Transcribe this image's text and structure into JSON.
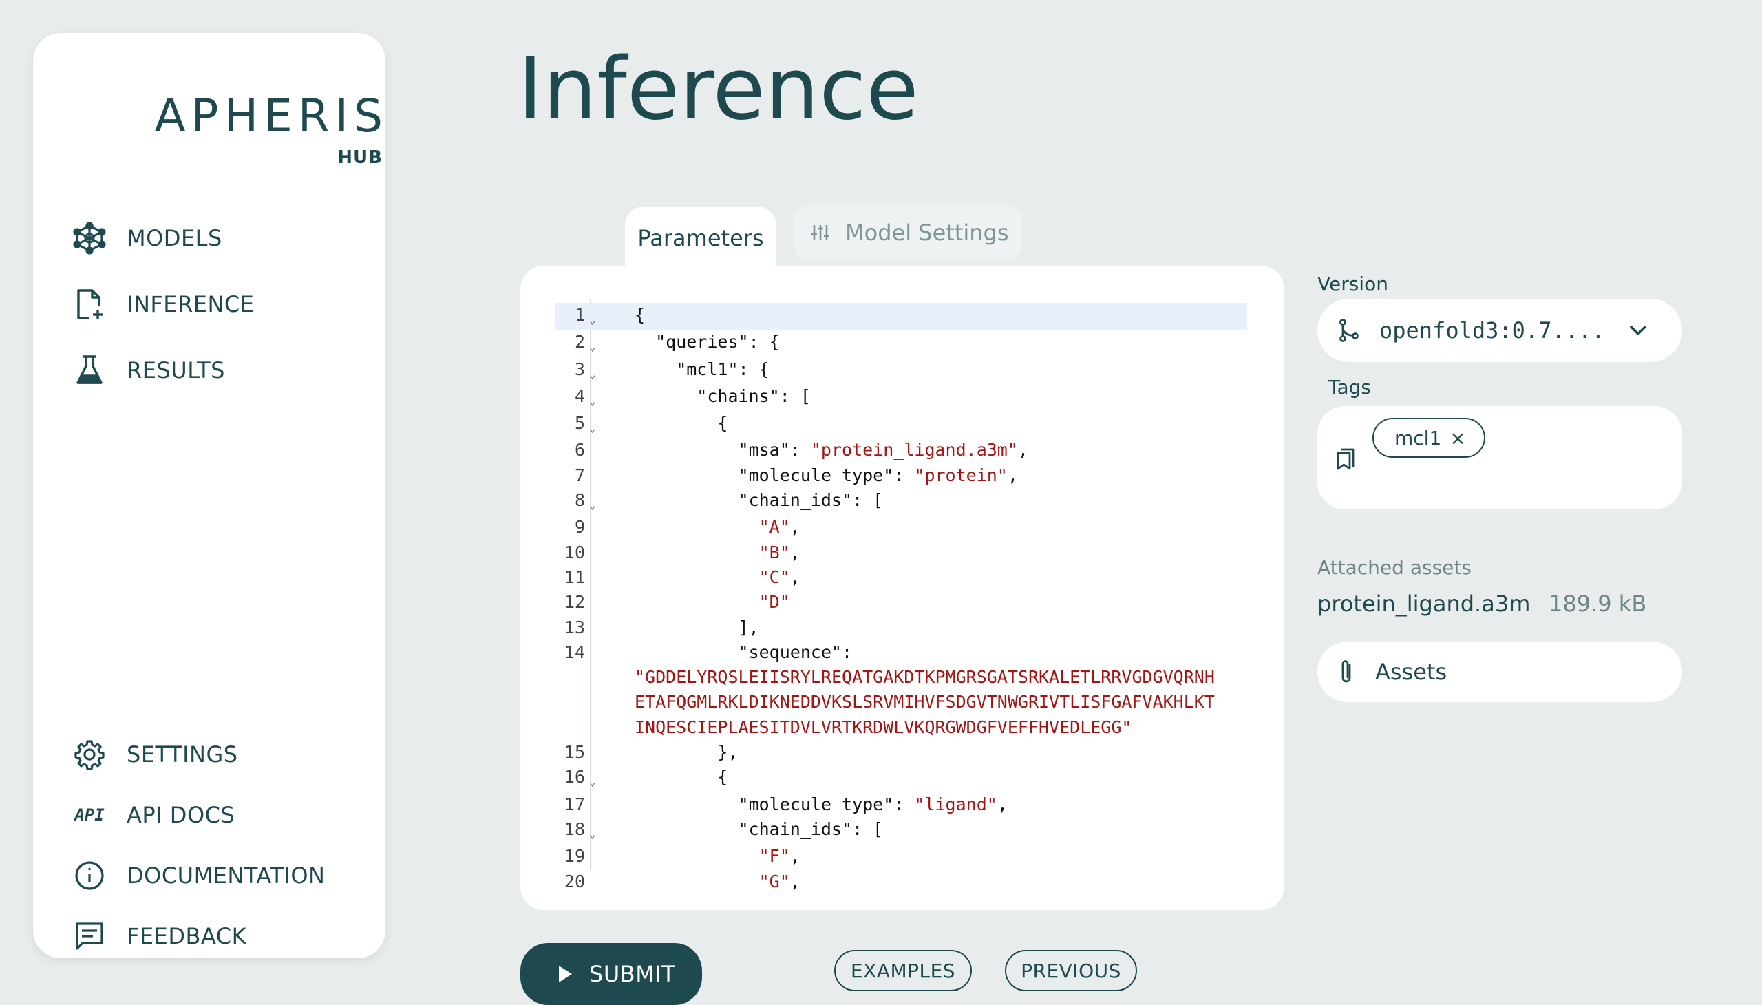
{
  "brand": {
    "name": "APHERIS",
    "sub": "HUB"
  },
  "nav": {
    "models": "MODELS",
    "inference": "INFERENCE",
    "results": "RESULTS",
    "settings": "SETTINGS",
    "api_docs": "API DOCS",
    "api_glyph": "API",
    "documentation": "DOCUMENTATION",
    "feedback": "FEEDBACK"
  },
  "page": {
    "title": "Inference"
  },
  "tabs": {
    "parameters": "Parameters",
    "model_settings": "Model Settings"
  },
  "editor": {
    "active_line": 1,
    "lines": [
      {
        "num": "1",
        "fold": true,
        "text": "{"
      },
      {
        "num": "2",
        "fold": true,
        "text": "  \"queries\": {"
      },
      {
        "num": "3",
        "fold": true,
        "text": "    \"mcl1\": {"
      },
      {
        "num": "4",
        "fold": true,
        "text": "      \"chains\": ["
      },
      {
        "num": "5",
        "fold": true,
        "text": "        {"
      },
      {
        "num": "6",
        "fold": false,
        "text": "          \"msa\": ",
        "str": "\"protein_ligand.a3m\"",
        "tail": ","
      },
      {
        "num": "7",
        "fold": false,
        "text": "          \"molecule_type\": ",
        "str": "\"protein\"",
        "tail": ","
      },
      {
        "num": "8",
        "fold": true,
        "text": "          \"chain_ids\": ["
      },
      {
        "num": "9",
        "fold": false,
        "text": "            ",
        "str": "\"A\"",
        "tail": ","
      },
      {
        "num": "10",
        "fold": false,
        "text": "            ",
        "str": "\"B\"",
        "tail": ","
      },
      {
        "num": "11",
        "fold": false,
        "text": "            ",
        "str": "\"C\"",
        "tail": ","
      },
      {
        "num": "12",
        "fold": false,
        "text": "            ",
        "str": "\"D\"",
        "tail": ""
      },
      {
        "num": "13",
        "fold": false,
        "text": "          ],"
      },
      {
        "num": "14",
        "fold": false,
        "text": "          \"sequence\":"
      },
      {
        "num": "",
        "wrap": true,
        "str": "\"GDDELYRQSLEIISRYLREQATGAKDTKPMGRSGATSRKALETLRRVGDGVQRNH"
      },
      {
        "num": "",
        "wrap": true,
        "str": "ETAFQGMLRKLDIKNEDDVKSLSRVMIHVFSDGVTNWGRIVTLISFGAFVAKHLKT"
      },
      {
        "num": "",
        "wrap": true,
        "str": "INQESCIEPLAESITDVLVRTKRDWLVKQRGWDGFVEFFHVEDLEGG\""
      },
      {
        "num": "15",
        "fold": false,
        "text": "        },"
      },
      {
        "num": "16",
        "fold": true,
        "text": "        {"
      },
      {
        "num": "17",
        "fold": false,
        "text": "          \"molecule_type\": ",
        "str": "\"ligand\"",
        "tail": ","
      },
      {
        "num": "18",
        "fold": true,
        "text": "          \"chain_ids\": ["
      },
      {
        "num": "19",
        "fold": false,
        "text": "            ",
        "str": "\"F\"",
        "tail": ","
      },
      {
        "num": "20",
        "fold": false,
        "text": "            ",
        "str": "\"G\"",
        "tail": ","
      }
    ]
  },
  "version": {
    "label": "Version",
    "value": "openfold3:0.7...."
  },
  "tags": {
    "label": "Tags",
    "items": [
      "mcl1"
    ]
  },
  "assets": {
    "label": "Attached assets",
    "file_name": "protein_ligand.a3m",
    "file_size": "189.9 kB",
    "button": "Assets"
  },
  "actions": {
    "submit": "SUBMIT",
    "examples": "EXAMPLES",
    "previous": "PREVIOUS"
  },
  "colors": {
    "primary": "#1e4a4f",
    "background": "#e9ecec",
    "string": "#a31515",
    "active_line": "#e8f1fb"
  }
}
